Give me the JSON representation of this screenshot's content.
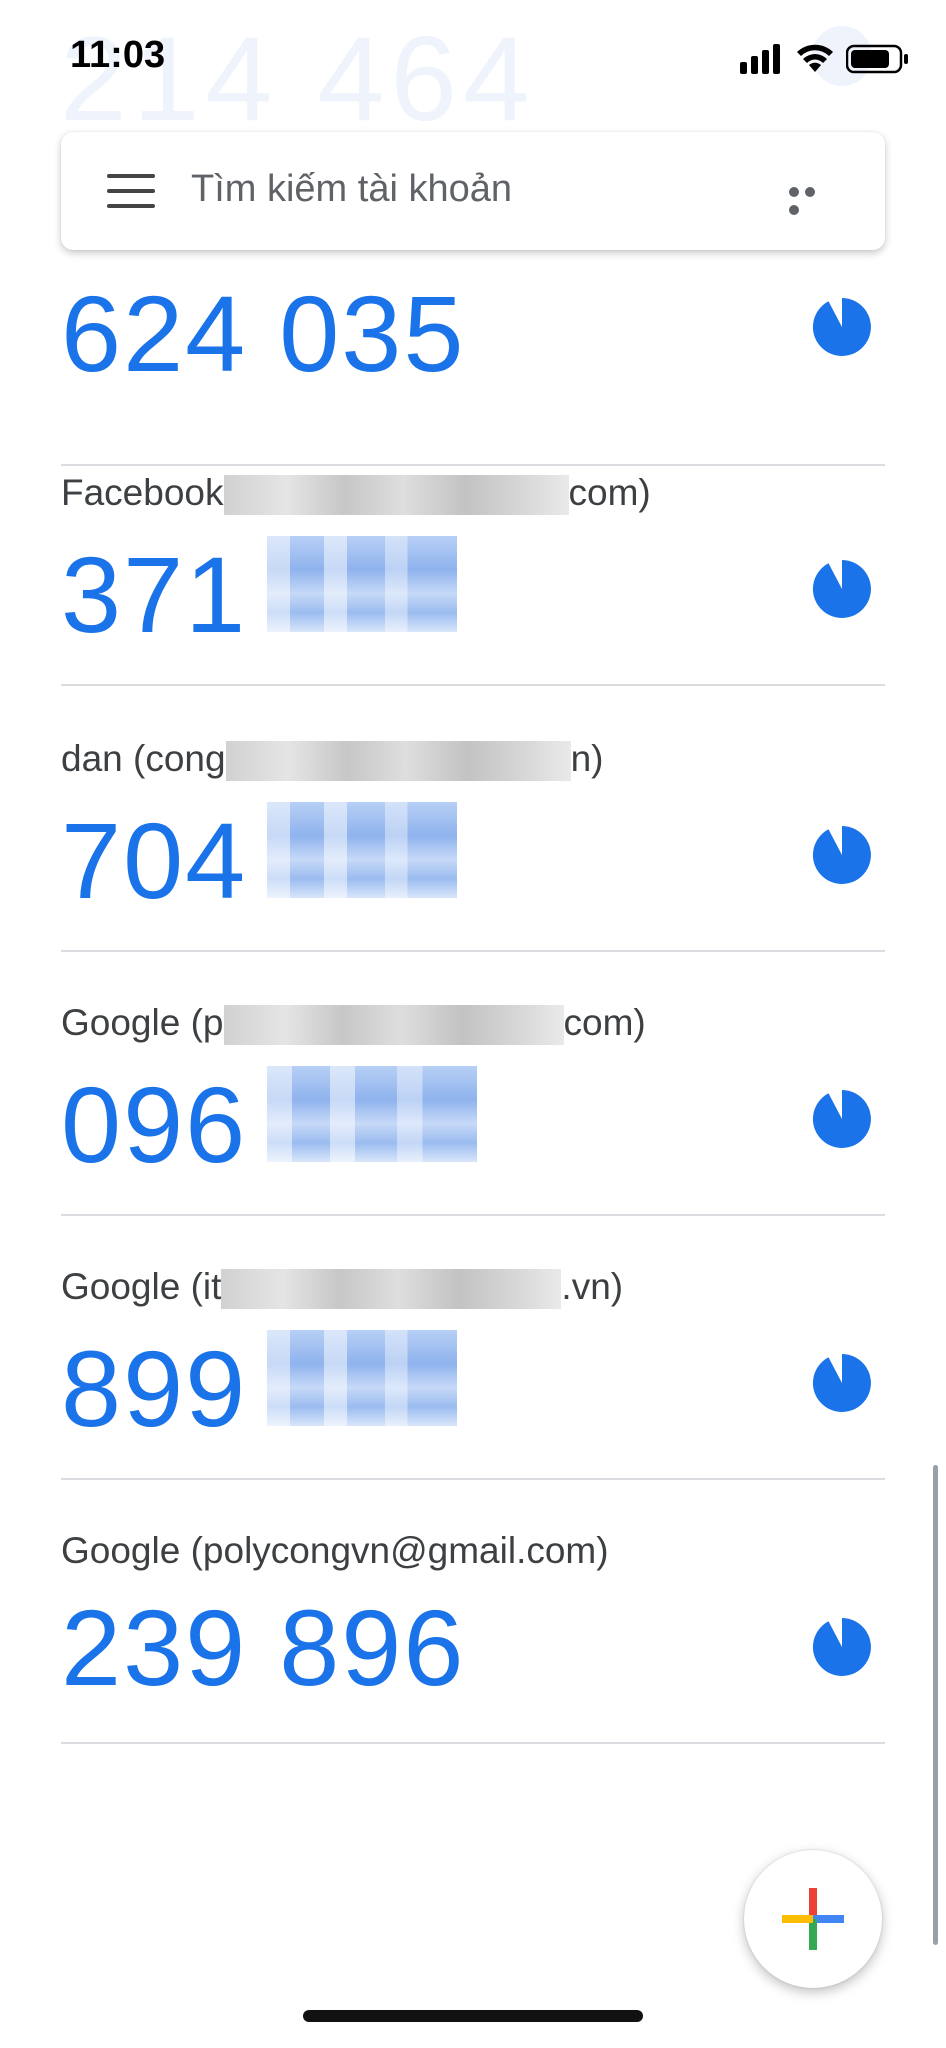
{
  "status_bar": {
    "time": "11:03",
    "background_code": "214 464"
  },
  "search": {
    "placeholder": "Tìm kiếm tài khoản",
    "menu_icon": "hamburger-menu-icon",
    "more_icon": "more-horizontal-icon"
  },
  "colors": {
    "code_blue": "#1a73e8",
    "label_gray": "#3c4043",
    "divider": "#dadce0"
  },
  "accounts": [
    {
      "name_prefix": "",
      "name_suffix": "",
      "code_visible": "624 035",
      "redacted": false,
      "timer_remaining": 0.8
    },
    {
      "name_prefix": "Facebook",
      "name_suffix": "com)",
      "code_visible": "371",
      "redacted": true,
      "timer_remaining": 0.8
    },
    {
      "name_prefix": "dan (cong",
      "name_suffix": "n)",
      "code_visible": "704",
      "redacted": true,
      "timer_remaining": 0.8
    },
    {
      "name_prefix": "Google (p",
      "name_suffix": "com)",
      "code_visible": "096",
      "redacted": true,
      "timer_remaining": 0.8
    },
    {
      "name_prefix": "Google (it",
      "name_suffix": ".vn)",
      "code_visible": "899",
      "redacted": true,
      "timer_remaining": 0.8
    },
    {
      "name_prefix": "Google (polycongvn@gmail.com)",
      "name_suffix": "",
      "code_visible": "239 896",
      "redacted": false,
      "timer_remaining": 0.8
    }
  ],
  "fab": {
    "icon": "plus-icon",
    "plus_colors": [
      "#4285f4",
      "#ea4335",
      "#fbbc04",
      "#34a853"
    ]
  }
}
